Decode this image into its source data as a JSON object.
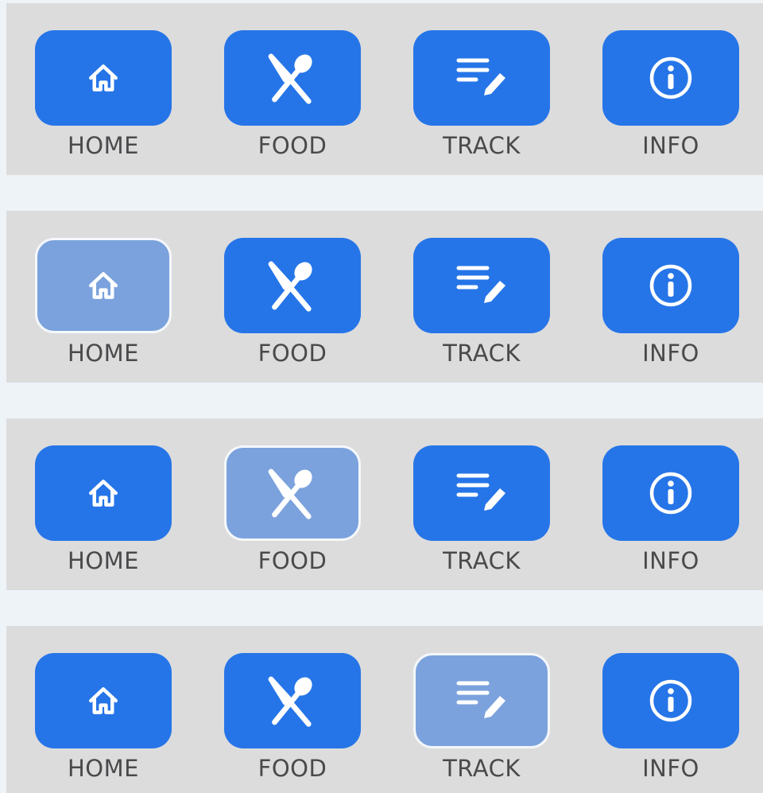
{
  "colors": {
    "active_button": "#2675e8",
    "selected_button": "#7ba2dd",
    "bar_background": "#dcdcdd",
    "page_background": "#eef3f8",
    "label_text": "#4a4a4c",
    "icon": "#ffffff"
  },
  "nav_bars": [
    {
      "items": [
        {
          "label": "HOME",
          "icon": "home-icon",
          "selected": false
        },
        {
          "label": "FOOD",
          "icon": "utensils-icon",
          "selected": false
        },
        {
          "label": "TRACK",
          "icon": "notes-edit-icon",
          "selected": false
        },
        {
          "label": "INFO",
          "icon": "info-icon",
          "selected": false
        }
      ]
    },
    {
      "items": [
        {
          "label": "HOME",
          "icon": "home-icon",
          "selected": true
        },
        {
          "label": "FOOD",
          "icon": "utensils-icon",
          "selected": false
        },
        {
          "label": "TRACK",
          "icon": "notes-edit-icon",
          "selected": false
        },
        {
          "label": "INFO",
          "icon": "info-icon",
          "selected": false
        }
      ]
    },
    {
      "items": [
        {
          "label": "HOME",
          "icon": "home-icon",
          "selected": false
        },
        {
          "label": "FOOD",
          "icon": "utensils-icon",
          "selected": true
        },
        {
          "label": "TRACK",
          "icon": "notes-edit-icon",
          "selected": false
        },
        {
          "label": "INFO",
          "icon": "info-icon",
          "selected": false
        }
      ]
    },
    {
      "items": [
        {
          "label": "HOME",
          "icon": "home-icon",
          "selected": false
        },
        {
          "label": "FOOD",
          "icon": "utensils-icon",
          "selected": false
        },
        {
          "label": "TRACK",
          "icon": "notes-edit-icon",
          "selected": true
        },
        {
          "label": "INFO",
          "icon": "info-icon",
          "selected": false
        }
      ]
    }
  ]
}
